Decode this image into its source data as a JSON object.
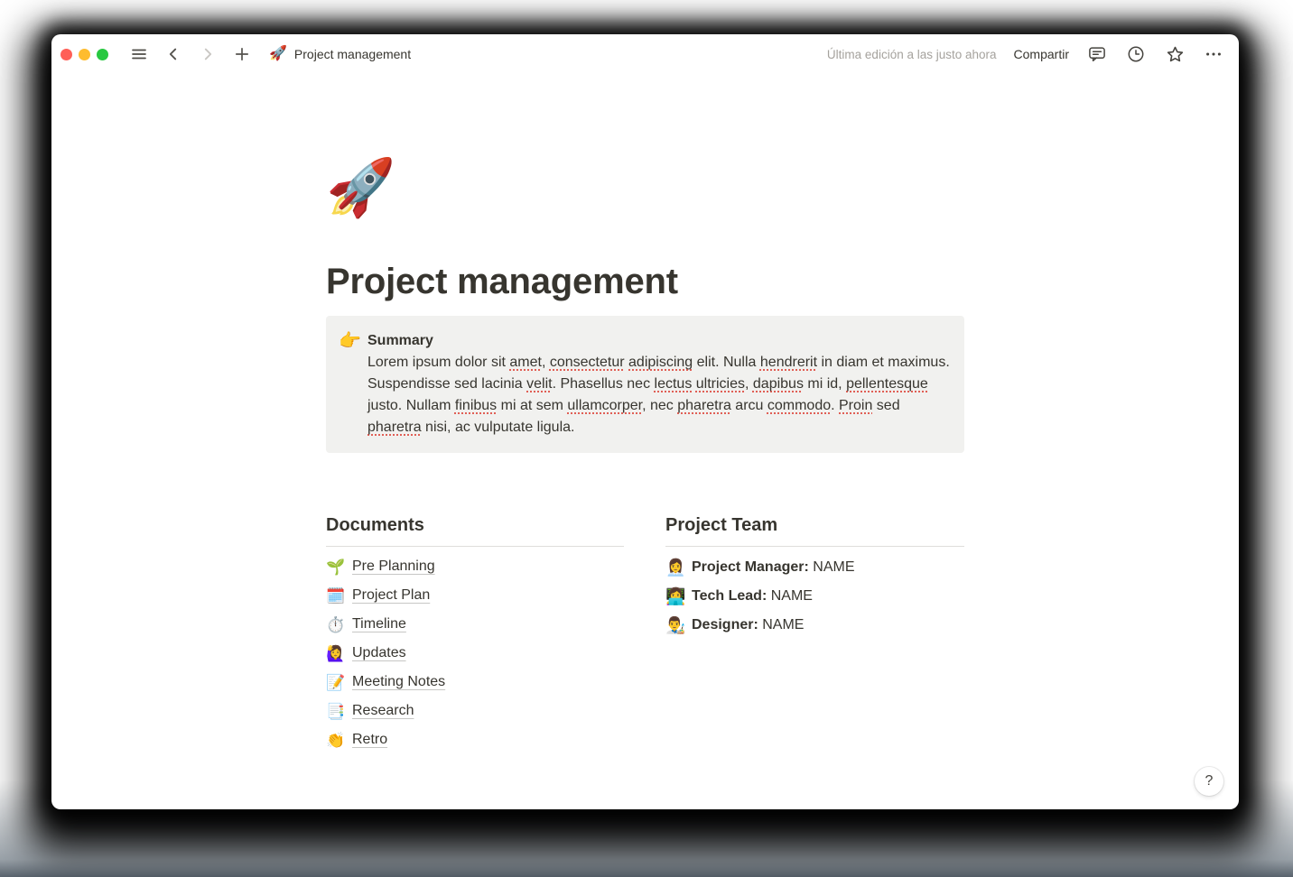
{
  "colors": {
    "traffic_red": "#ff5f57",
    "traffic_yellow": "#febc2e",
    "traffic_green": "#28c840",
    "text_primary": "#37352f",
    "text_muted": "#a5a29d",
    "callout_bg": "#f1f1ef",
    "spellcheck_red": "#e05f55"
  },
  "toolbar": {
    "breadcrumb_icon": "🚀",
    "breadcrumb_label": "Project management",
    "edited_status": "Última edición a las justo ahora",
    "share_label": "Compartir"
  },
  "page": {
    "icon": "🚀",
    "title": "Project management",
    "callout": {
      "icon": "👉",
      "heading": "Summary",
      "segments": [
        {
          "text": "Lorem ipsum dolor sit "
        },
        {
          "text": "amet",
          "misspelled": true
        },
        {
          "text": ", "
        },
        {
          "text": "consectetur",
          "misspelled": true
        },
        {
          "text": " "
        },
        {
          "text": "adipiscing",
          "misspelled": true
        },
        {
          "text": " elit. Nulla "
        },
        {
          "text": "hendrerit",
          "misspelled": true
        },
        {
          "text": " in diam et maximus. Suspendisse sed lacinia "
        },
        {
          "text": "velit",
          "misspelled": true
        },
        {
          "text": ". Phasellus nec "
        },
        {
          "text": "lectus",
          "misspelled": true
        },
        {
          "text": " "
        },
        {
          "text": "ultricies",
          "misspelled": true
        },
        {
          "text": ", "
        },
        {
          "text": "dapibus",
          "misspelled": true
        },
        {
          "text": " mi id, "
        },
        {
          "text": "pellentesque",
          "misspelled": true
        },
        {
          "text": " justo. Nullam "
        },
        {
          "text": "finibus",
          "misspelled": true
        },
        {
          "text": " mi at sem "
        },
        {
          "text": "ullamcorper",
          "misspelled": true
        },
        {
          "text": ", nec "
        },
        {
          "text": "pharetra",
          "misspelled": true
        },
        {
          "text": " arcu "
        },
        {
          "text": "commodo",
          "misspelled": true
        },
        {
          "text": ". "
        },
        {
          "text": "Proin",
          "misspelled": true
        },
        {
          "text": " sed "
        },
        {
          "text": "pharetra",
          "misspelled": true
        },
        {
          "text": " nisi, ac vulputate ligula."
        }
      ]
    },
    "documents": {
      "heading": "Documents",
      "items": [
        {
          "icon": "🌱",
          "label": "Pre Planning"
        },
        {
          "icon": "🗓️",
          "label": "Project Plan"
        },
        {
          "icon": "⏱️",
          "label": "Timeline"
        },
        {
          "icon": "🙋‍♀️",
          "label": "Updates"
        },
        {
          "icon": "📝",
          "label": "Meeting Notes"
        },
        {
          "icon": "📑",
          "label": "Research"
        },
        {
          "icon": "👏",
          "label": "Retro"
        }
      ]
    },
    "team": {
      "heading": "Project Team",
      "members": [
        {
          "icon": "👩‍💼",
          "role": "Project Manager:",
          "name": "NAME"
        },
        {
          "icon": "👩‍💻",
          "role": "Tech Lead:",
          "name": "NAME"
        },
        {
          "icon": "👨‍🎨",
          "role": "Designer:",
          "name": "NAME"
        }
      ]
    },
    "help_label": "?"
  }
}
